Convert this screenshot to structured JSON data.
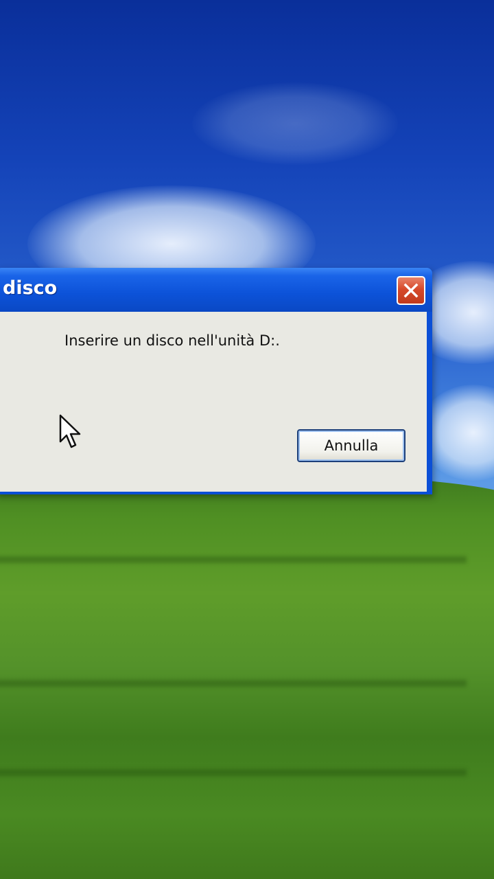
{
  "dialog": {
    "title": "disco",
    "message": "Inserire un disco nell'unità D:.",
    "cancel_label": "Annulla"
  },
  "icons": {
    "close": "close-icon",
    "cursor": "mouse-pointer-icon"
  },
  "colors": {
    "titlebar": "#0c52d8",
    "dialog_body": "#e9e9e3",
    "close_button": "#d6492a",
    "sky": "#1443b8",
    "grass": "#5f9d2a"
  }
}
